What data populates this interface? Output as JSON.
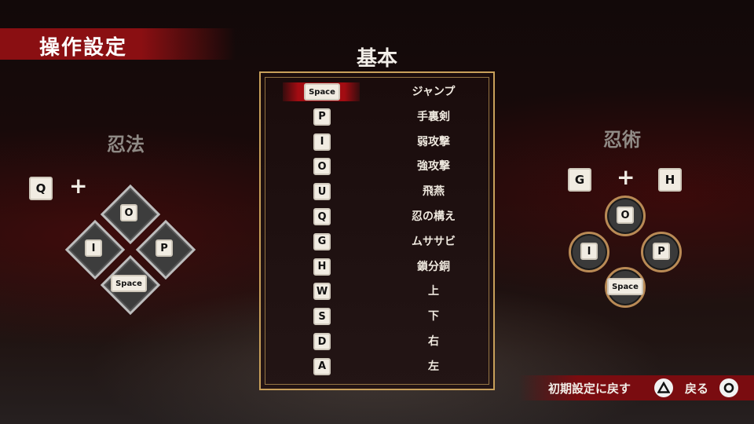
{
  "header": {
    "title": "操作設定"
  },
  "tab": {
    "title": "基本"
  },
  "bindings": [
    {
      "key": "Space",
      "action": "ジャンプ"
    },
    {
      "key": "P",
      "action": "手裏剣"
    },
    {
      "key": "I",
      "action": "弱攻撃"
    },
    {
      "key": "O",
      "action": "強攻撃"
    },
    {
      "key": "U",
      "action": "飛燕"
    },
    {
      "key": "Q",
      "action": "忍の構え"
    },
    {
      "key": "G",
      "action": "ムササビ"
    },
    {
      "key": "H",
      "action": "鎖分銅"
    },
    {
      "key": "W",
      "action": "上"
    },
    {
      "key": "S",
      "action": "下"
    },
    {
      "key": "D",
      "action": "右"
    },
    {
      "key": "A",
      "action": "左"
    }
  ],
  "selected_index": 0,
  "ninpo": {
    "title": "忍法",
    "modifier": "Q",
    "plus": "+",
    "keys": {
      "top": "O",
      "left": "I",
      "right": "P",
      "bottom": "Space"
    }
  },
  "ninjutsu": {
    "title": "忍術",
    "modifier1": "G",
    "plus": "+",
    "modifier2": "H",
    "keys": {
      "top": "O",
      "left": "I",
      "right": "P",
      "bottom": "Space"
    }
  },
  "footer": {
    "reset_label": "初期設定に戻す",
    "reset_icon": "triangle-icon",
    "back_label": "戻る",
    "back_icon": "circle-icon"
  },
  "colors": {
    "accent": "#8a0f12",
    "frame": "#c8a05a"
  }
}
